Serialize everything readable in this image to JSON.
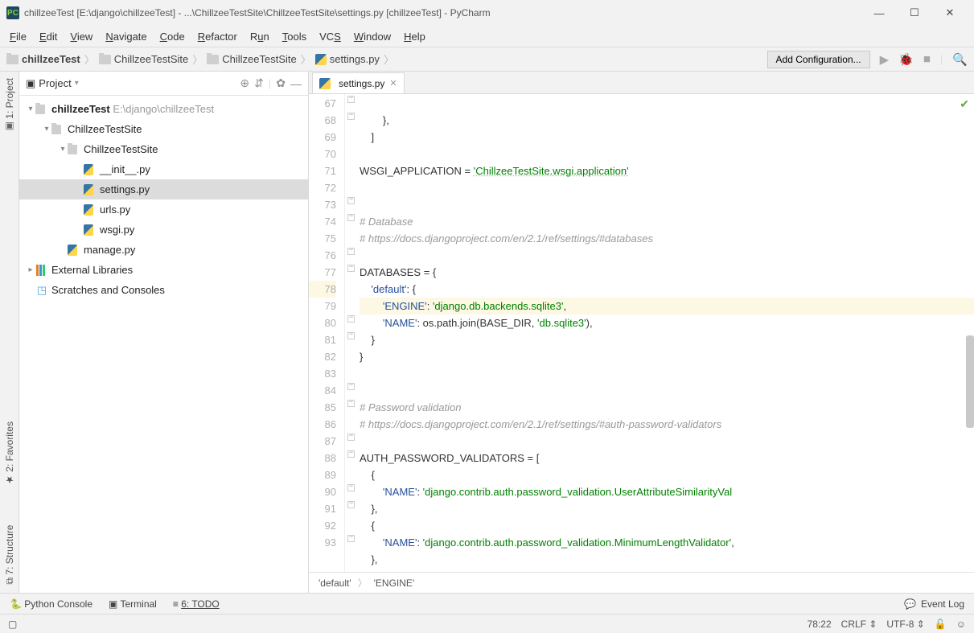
{
  "title": "chillzeeTest [E:\\django\\chillzeeTest] - ...\\ChillzeeTestSite\\ChillzeeTestSite\\settings.py [chillzeeTest] - PyCharm",
  "menu": [
    "File",
    "Edit",
    "View",
    "Navigate",
    "Code",
    "Refactor",
    "Run",
    "Tools",
    "VCS",
    "Window",
    "Help"
  ],
  "breadcrumbs": [
    {
      "type": "folder",
      "label": "chillzeeTest",
      "bold": true
    },
    {
      "type": "folder",
      "label": "ChillzeeTestSite"
    },
    {
      "type": "folder",
      "label": "ChillzeeTestSite"
    },
    {
      "type": "py",
      "label": "settings.py"
    }
  ],
  "add_config": "Add Configuration...",
  "panel_title": "Project",
  "tree": {
    "root": {
      "name": "chillzeeTest",
      "path": "E:\\django\\chillzeeTest"
    },
    "l1": "ChillzeeTestSite",
    "l2": "ChillzeeTestSite",
    "files": [
      "__init__.py",
      "settings.py",
      "urls.py",
      "wsgi.py"
    ],
    "manage": "manage.py",
    "ext": "External Libraries",
    "scratch": "Scratches and Consoles"
  },
  "tab": "settings.py",
  "lines_start": 67,
  "lines_end": 93,
  "code": {
    "l67": "        },",
    "l68": "    ]",
    "l70a": "WSGI_APPLICATION = ",
    "l70b": "'ChillzeeTestSite.wsgi.application'",
    "l73": "# Database",
    "l74": "# https://docs.djangoproject.com/en/2.1/ref/settings/#databases",
    "l76": "DATABASES = {",
    "l77a": "    ",
    "l77b": "'default'",
    "l77c": ": {",
    "l78a": "        ",
    "l78b": "'ENGINE'",
    "l78c": ": ",
    "l78d": "'django.db.backends.sqlite3'",
    "l78e": ",",
    "l79a": "        ",
    "l79b": "'NAME'",
    "l79c": ": os.path.join(BASE_DIR, ",
    "l79d": "'db.sqlite3'",
    "l79e": "),",
    "l80": "    }",
    "l81": "}",
    "l84": "# Password validation",
    "l85": "# https://docs.djangoproject.com/en/2.1/ref/settings/#auth-password-validators",
    "l87": "AUTH_PASSWORD_VALIDATORS = [",
    "l88": "    {",
    "l89a": "        ",
    "l89b": "'NAME'",
    "l89c": ": ",
    "l89d": "'django.contrib.auth.password_validation.UserAttributeSimilarityVal",
    "l90": "    },",
    "l91": "    {",
    "l92a": "        ",
    "l92b": "'NAME'",
    "l92c": ": ",
    "l92d": "'django.contrib.auth.password_validation.MinimumLengthValidator'",
    "l92e": ",",
    "l93": "    },"
  },
  "bottom_crumb": [
    "'default'",
    "'ENGINE'"
  ],
  "bottom_tools": {
    "console": "Python Console",
    "terminal": "Terminal",
    "todo": "6: TODO",
    "event": "Event Log"
  },
  "status": {
    "pos": "78:22",
    "eol": "CRLF",
    "enc": "UTF-8"
  },
  "left_tabs": [
    "1: Project",
    "2: Favorites",
    "7: Structure"
  ]
}
